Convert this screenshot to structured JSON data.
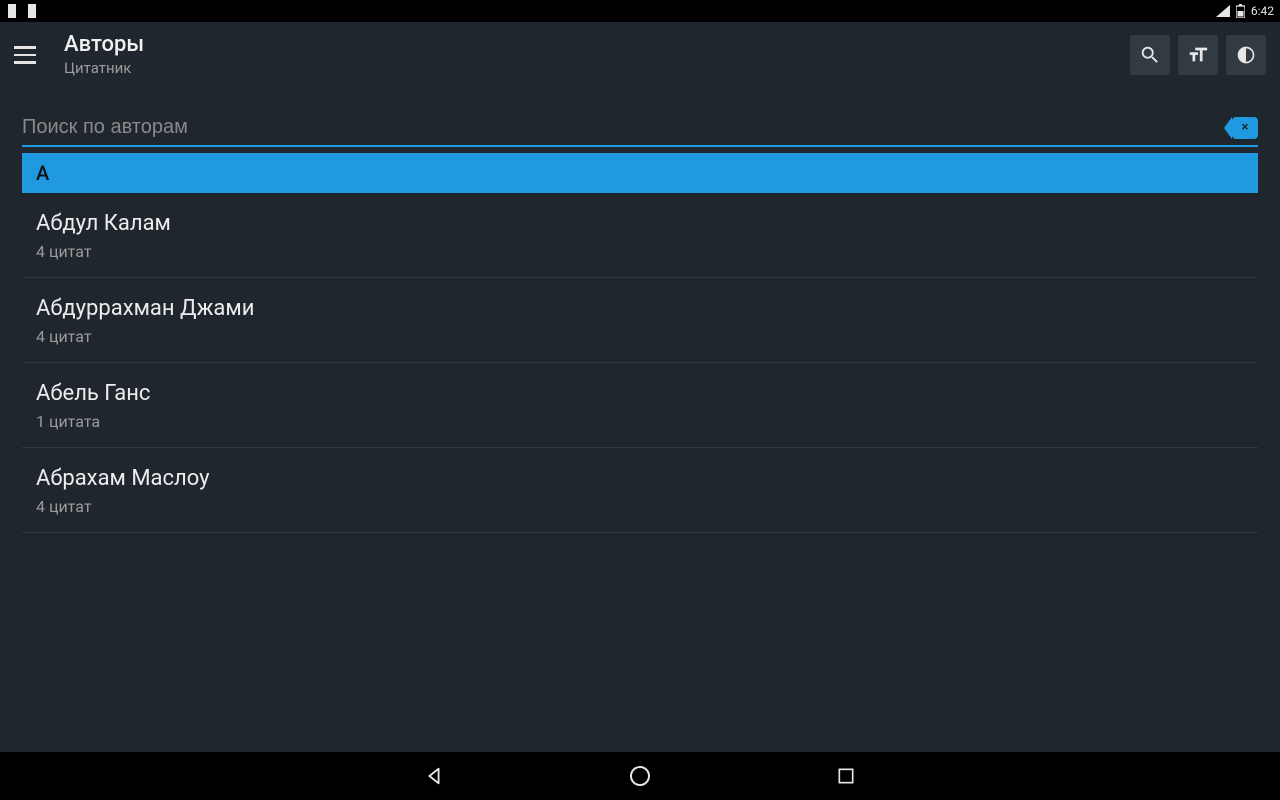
{
  "status": {
    "time": "6:42"
  },
  "header": {
    "title": "Авторы",
    "subtitle": "Цитатник"
  },
  "search": {
    "placeholder": "Поиск по авторам",
    "clear_label": "×"
  },
  "list": {
    "section": "A",
    "items": [
      {
        "name": "Абдул Калам",
        "count": "4 цитат"
      },
      {
        "name": "Абдуррахман Джами",
        "count": "4 цитат"
      },
      {
        "name": "Абель Ганс",
        "count": "1 цитата"
      },
      {
        "name": "Абрахам Маслоу",
        "count": "4 цитат"
      }
    ]
  },
  "colors": {
    "accent": "#1f9ae0",
    "bg": "#1f262d"
  }
}
